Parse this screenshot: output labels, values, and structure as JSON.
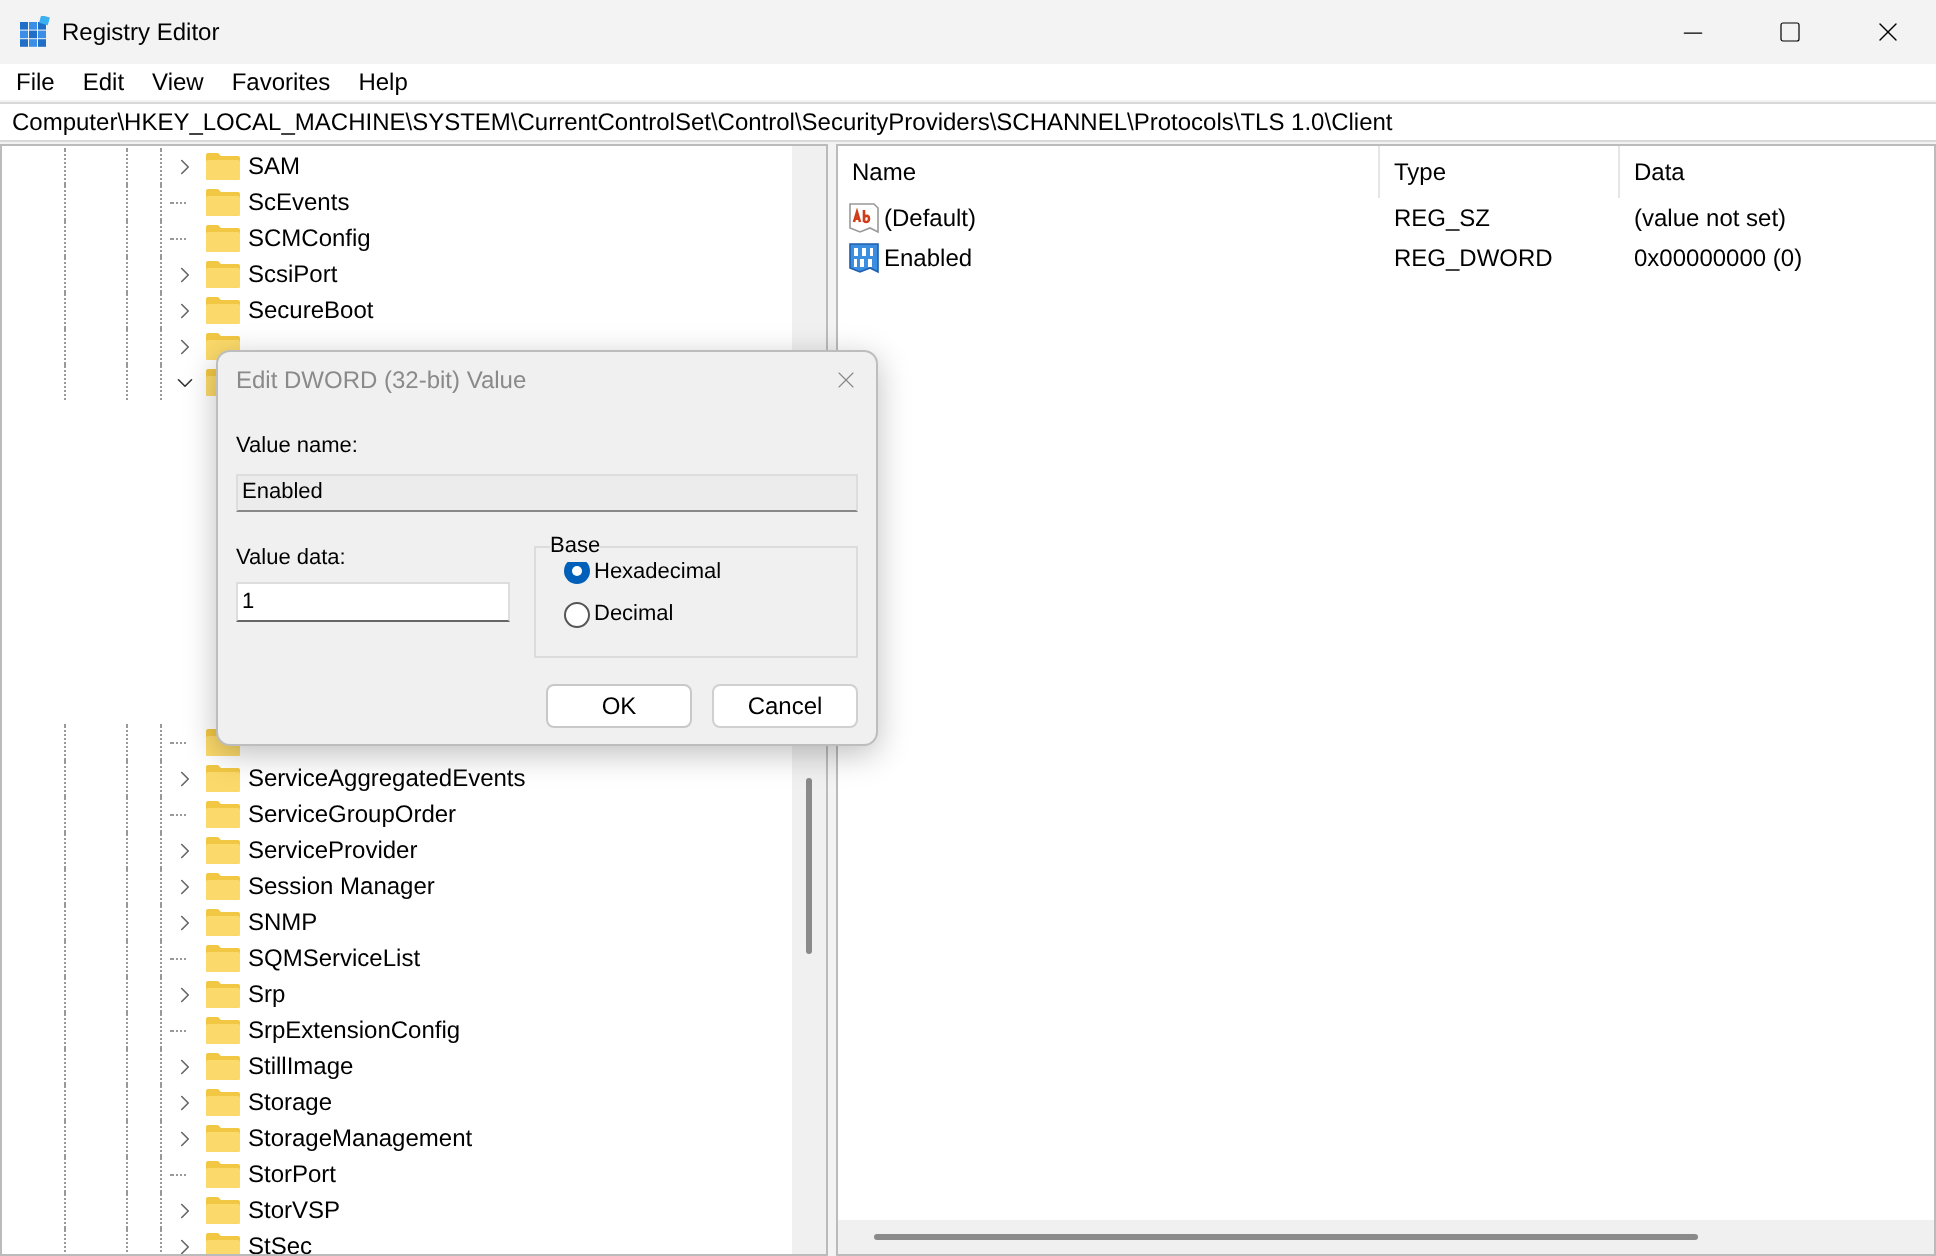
{
  "window": {
    "title": "Registry Editor"
  },
  "menu": [
    "File",
    "Edit",
    "View",
    "Favorites",
    "Help"
  ],
  "address": "Computer\\HKEY_LOCAL_MACHINE\\SYSTEM\\CurrentControlSet\\Control\\SecurityProviders\\SCHANNEL\\Protocols\\TLS 1.0\\Client",
  "tree": {
    "items": [
      {
        "label": "SAM",
        "kind": "collapsed"
      },
      {
        "label": "ScEvents",
        "kind": "leaf"
      },
      {
        "label": "SCMConfig",
        "kind": "leaf"
      },
      {
        "label": "ScsiPort",
        "kind": "collapsed"
      },
      {
        "label": "SecureBoot",
        "kind": "collapsed"
      },
      {
        "kind": "collapsed"
      },
      {
        "kind": "expanded"
      },
      {
        "kind": "leaf"
      },
      {
        "label": "ServiceAggregatedEvents",
        "kind": "collapsed"
      },
      {
        "label": "ServiceGroupOrder",
        "kind": "leaf"
      },
      {
        "label": "ServiceProvider",
        "kind": "collapsed"
      },
      {
        "label": "Session Manager",
        "kind": "collapsed"
      },
      {
        "label": "SNMP",
        "kind": "collapsed"
      },
      {
        "label": "SQMServiceList",
        "kind": "leaf"
      },
      {
        "label": "Srp",
        "kind": "collapsed"
      },
      {
        "label": "SrpExtensionConfig",
        "kind": "leaf"
      },
      {
        "label": "StillImage",
        "kind": "collapsed"
      },
      {
        "label": "Storage",
        "kind": "collapsed"
      },
      {
        "label": "StorageManagement",
        "kind": "collapsed"
      },
      {
        "label": "StorPort",
        "kind": "leaf"
      },
      {
        "label": "StorVSP",
        "kind": "collapsed"
      },
      {
        "label": "StSec",
        "kind": "collapsed"
      }
    ]
  },
  "values": {
    "columns": [
      "Name",
      "Type",
      "Data"
    ],
    "rows": [
      {
        "name": "(Default)",
        "kind": "string",
        "type": "REG_SZ",
        "data": "(value not set)"
      },
      {
        "name": "Enabled",
        "kind": "binary",
        "type": "REG_DWORD",
        "data": "0x00000000 (0)"
      }
    ]
  },
  "dialog": {
    "title": "Edit DWORD (32-bit) Value",
    "name_label": "Value name:",
    "name_value": "Enabled",
    "data_label": "Value data:",
    "data_value": "1",
    "base_label": "Base",
    "bases": [
      {
        "label": "Hexadecimal",
        "selected": true
      },
      {
        "label": "Decimal",
        "selected": false
      }
    ],
    "buttons": [
      {
        "label": "OK",
        "kind": "default"
      },
      {
        "label": "Cancel",
        "kind": "normal"
      }
    ]
  }
}
